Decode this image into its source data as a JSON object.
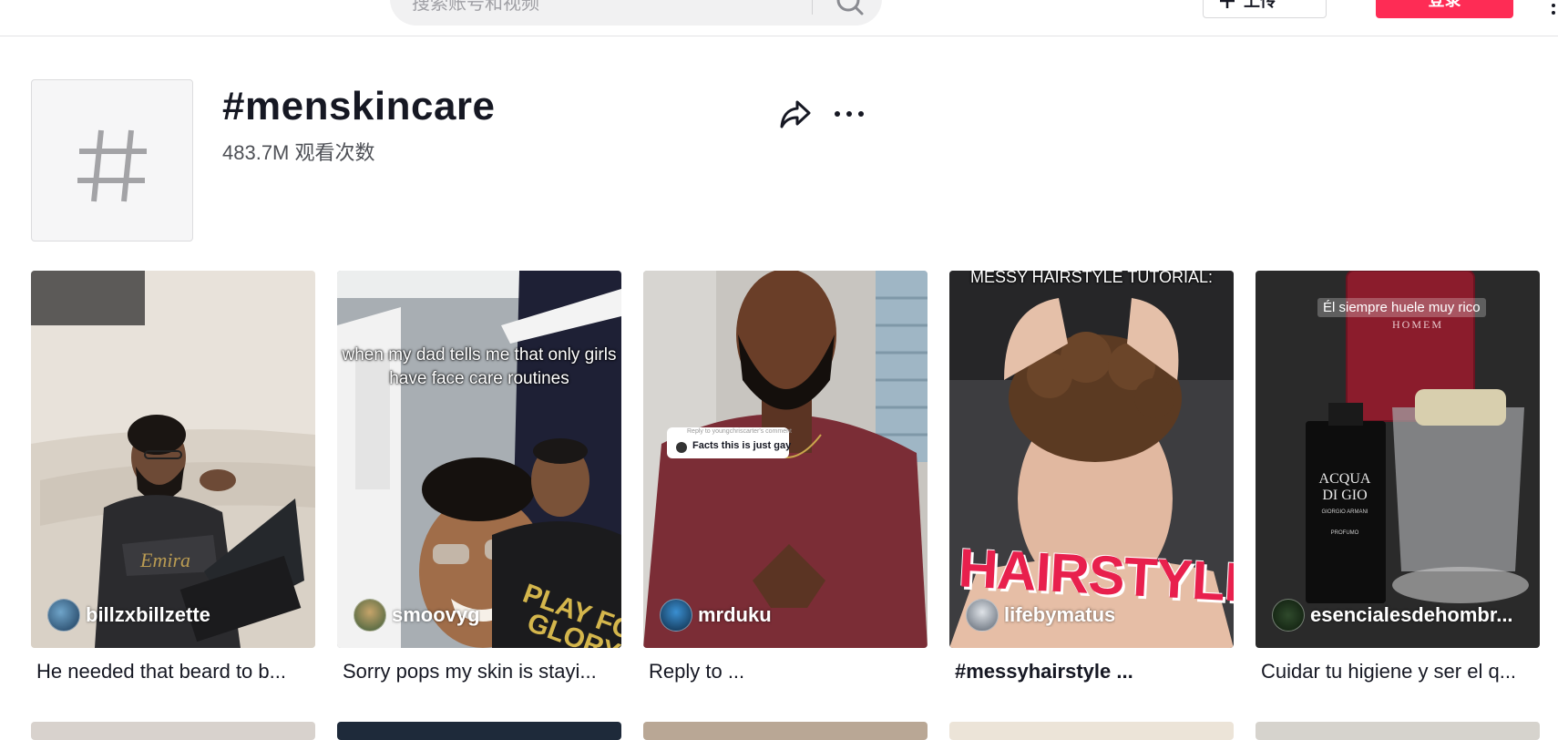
{
  "header": {
    "search_placeholder": "搜索账号和视频",
    "upload_label": "上传",
    "login_label": "登录"
  },
  "tag": {
    "title": "#menskincare",
    "views": "483.7M 观看次数",
    "icon": "hashtag-icon"
  },
  "videos": [
    {
      "author": "billzxbillzette",
      "caption": "He needed that beard to b...",
      "overlay": ""
    },
    {
      "author": "smoovyg",
      "caption": "Sorry pops my skin is stayi...",
      "overlay": "when my dad tells me that only girls have face care routines"
    },
    {
      "author": "mrduku",
      "caption": "Reply to ...",
      "overlay": "Facts this is just gay",
      "overlay_small": "Reply to youngchriscarter's comment"
    },
    {
      "author": "lifebymatus",
      "caption": "#messyhairstyle ...",
      "overlay": "MESSY HAIRSTYLE TUTORIAL:",
      "overlay_big": "HAIRSTYLE"
    },
    {
      "author": "esencialesdehombr...",
      "caption": "Cuidar tu higiene y ser el q...",
      "overlay": "Él siempre huele muy rico",
      "bottle_brand": "ACQUA DI GIO",
      "bottle_sub": "GIORGIO ARMANI",
      "bottle_name": "PROFUMO",
      "bottle2_brand": "HOMEM"
    }
  ],
  "colors": {
    "accent": "#fe2c55",
    "text": "#161823",
    "muted": "#4e5056"
  }
}
